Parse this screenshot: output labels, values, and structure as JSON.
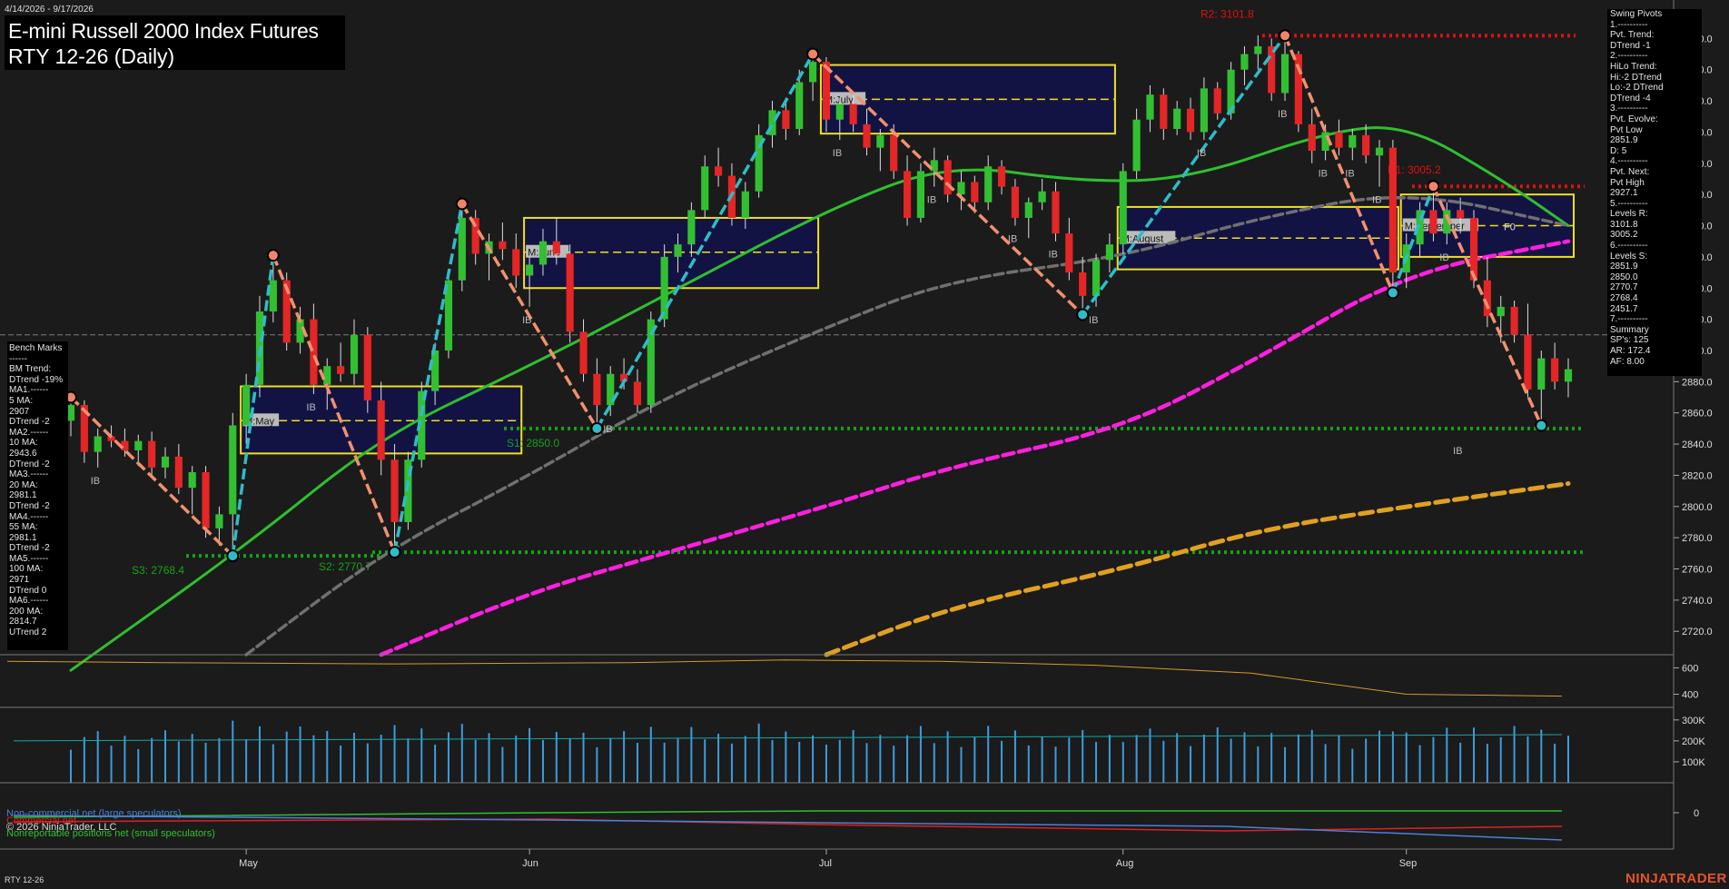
{
  "header": {
    "date_range": "4/14/2026 - 9/17/2026",
    "title_line1": "E-mini Russell 2000 Index Futures",
    "title_line2": "RTY 12-26 (Daily)",
    "instrument_footer": "RTY 12-26",
    "brand": "NINJATRADER"
  },
  "benchmarks": {
    "title": "Bench Marks",
    "lines": [
      "------",
      "BM Trend:",
      "DTrend -19%",
      "MA1.------",
      "5 MA:",
      "2907",
      "DTrend -2",
      "MA2.------",
      "10 MA:",
      "2943.6",
      "DTrend -2",
      "MA3.------",
      "20 MA:",
      "2981.1",
      "DTrend -2",
      "MA4.------",
      "55 MA:",
      "2981.1",
      "DTrend -2",
      "MA5.------",
      "100 MA:",
      "2971",
      "DTrend 0",
      "MA6.------",
      "200 MA:",
      "2814.7",
      "UTrend 2"
    ]
  },
  "swing_pivots": {
    "title": "Swing Pivots",
    "lines": [
      "1.----------",
      "Pvt. Trend:",
      "DTrend -1",
      "2.----------",
      "HiLo Trend:",
      "Hi:-2 DTrend",
      "Lo:-2 DTrend",
      "DTrend -4",
      "3.----------",
      "Pvt. Evolve:",
      "Pvt Low",
      "2851.9",
      "D: 5",
      "4.----------",
      "Pvt. Next:",
      "Pvt High",
      "2927.1",
      "5.----------",
      "Levels R:",
      "3101.8",
      "3005.2",
      "6.----------",
      "Levels S:",
      "2851.9",
      "2850.0",
      "2770.7",
      "2768.4",
      "2451.7",
      "7.----------",
      "Summary",
      "SP's: 125",
      "AR: 172.4",
      "AF: 8.00"
    ]
  },
  "cot": {
    "noncommercial": "Non-commercial net (large speculators)",
    "commercial": "Commercial net",
    "copyright": "© 2026 NinjaTrader, LLC",
    "nonreportable": "Nonreportable positions net (small speculators)"
  },
  "colors": {
    "background": "#1b1b1b",
    "up_candle": "#32c032",
    "down_candle": "#e42626",
    "ma_green": "#2fbf2f",
    "ma_gray": "#707070",
    "ma_magenta": "#ff1fe0",
    "ma_gold": "#e0a020",
    "swing_up": "#2fbcc8",
    "swing_down": "#f2906e",
    "resistance": "#e01010",
    "support": "#16a316",
    "box_border": "#f0e020",
    "box_fill": "#12124a"
  },
  "chart_data": {
    "type": "candlestick",
    "y_axis": {
      "min": 2705,
      "max": 3120,
      "ticks": [
        3100,
        3080,
        3060,
        3040,
        3020,
        3000,
        2980,
        2960,
        2940,
        2920,
        2900,
        2880,
        2860,
        2840,
        2820,
        2800,
        2780,
        2760,
        2740,
        2720
      ]
    },
    "x_axis": {
      "start_date": "4/14/2026",
      "end_date": "9/17/2026",
      "month_labels": [
        {
          "label": "May",
          "date": "5/1"
        },
        {
          "label": "Jun",
          "date": "6/1"
        },
        {
          "label": "Jul",
          "date": "7/1"
        },
        {
          "label": "Aug",
          "date": "8/3"
        },
        {
          "label": "Sep",
          "date": "9/1"
        }
      ]
    },
    "swing_points": [
      {
        "date": "4/14",
        "price": 2870,
        "type": "high"
      },
      {
        "date": "4/30",
        "price": 2768.4,
        "type": "low"
      },
      {
        "date": "5/5",
        "price": 2961,
        "type": "high"
      },
      {
        "date": "5/18",
        "price": 2770.7,
        "type": "low"
      },
      {
        "date": "5/25",
        "price": 2994,
        "type": "high"
      },
      {
        "date": "6/8",
        "price": 2850,
        "type": "low"
      },
      {
        "date": "6/30",
        "price": 3090,
        "type": "high"
      },
      {
        "date": "7/29",
        "price": 2923,
        "type": "low"
      },
      {
        "date": "8/19",
        "price": 3101.8,
        "type": "high"
      },
      {
        "date": "8/31",
        "price": 2937,
        "type": "low"
      },
      {
        "date": "9/3",
        "price": 3005.2,
        "type": "high"
      },
      {
        "date": "9/15",
        "price": 2851.9,
        "type": "low"
      }
    ],
    "ma_series": [
      {
        "name": "20 MA",
        "points": [
          [
            "4/14",
            2695
          ],
          [
            "5/1",
            2775
          ],
          [
            "5/15",
            2845
          ],
          [
            "6/1",
            2890
          ],
          [
            "6/15",
            2935
          ],
          [
            "7/1",
            2990
          ],
          [
            "7/15",
            3020
          ],
          [
            "7/29",
            3008
          ],
          [
            "8/10",
            3010
          ],
          [
            "8/24",
            3040
          ],
          [
            "9/1",
            3045
          ],
          [
            "9/10",
            3010
          ],
          [
            "9/17",
            2980
          ]
        ]
      },
      {
        "name": "55 MA",
        "points": [
          [
            "5/1",
            2705
          ],
          [
            "5/15",
            2770
          ],
          [
            "6/1",
            2820
          ],
          [
            "6/15",
            2870
          ],
          [
            "7/1",
            2915
          ],
          [
            "7/15",
            2945
          ],
          [
            "8/1",
            2960
          ],
          [
            "8/15",
            2985
          ],
          [
            "9/1",
            3003
          ],
          [
            "9/17",
            2980
          ]
        ]
      },
      {
        "name": "100 MA",
        "points": [
          [
            "5/15",
            2705
          ],
          [
            "6/1",
            2745
          ],
          [
            "6/15",
            2770
          ],
          [
            "7/1",
            2800
          ],
          [
            "7/15",
            2825
          ],
          [
            "8/1",
            2850
          ],
          [
            "8/15",
            2895
          ],
          [
            "9/1",
            2950
          ],
          [
            "9/17",
            2970
          ]
        ]
      },
      {
        "name": "200 MA",
        "points": [
          [
            "7/1",
            2705
          ],
          [
            "7/15",
            2735
          ],
          [
            "8/1",
            2760
          ],
          [
            "8/15",
            2785
          ],
          [
            "9/1",
            2800
          ],
          [
            "9/17",
            2814.7
          ]
        ]
      }
    ],
    "levels": [
      {
        "label": "R2: 3101.8",
        "price": 3101.8,
        "kind": "resistance"
      },
      {
        "label": "R1: 3005.2",
        "price": 3005.2,
        "kind": "resistance"
      },
      {
        "label": "S1: 2850.0",
        "price": 2850.0,
        "kind": "support"
      },
      {
        "label": "S2: 2770.7",
        "price": 2770.7,
        "kind": "support"
      },
      {
        "label": "S3: 2768.4",
        "price": 2768.4,
        "kind": "support"
      }
    ],
    "value_area_boxes": [
      {
        "label": "M:May",
        "start": "5/1",
        "end": "5/29",
        "high": 2877,
        "low": 2834,
        "poc": 2855
      },
      {
        "label": "M:June",
        "start": "6/1",
        "end": "6/30",
        "high": 2985,
        "low": 2940,
        "poc": 2963
      },
      {
        "label": "M:July",
        "start": "7/1",
        "end": "7/31",
        "high": 3083,
        "low": 3039,
        "poc": 3061
      },
      {
        "label": "M:August",
        "start": "8/3",
        "end": "8/31",
        "high": 2992,
        "low": 2952,
        "poc": 2972
      },
      {
        "label": "M:September",
        "start": "9/1",
        "end": "9/17",
        "high": 3000,
        "low": 2960,
        "poc": 2980
      }
    ],
    "ib_labels": [
      [
        "4/16",
        "IB"
      ],
      [
        "5/8",
        "IB"
      ],
      [
        "6/1",
        "IB"
      ],
      [
        "6/9",
        "IB"
      ],
      [
        "7/2",
        "IB"
      ],
      [
        "7/14",
        "IB"
      ],
      [
        "7/22",
        "IB"
      ],
      [
        "7/27",
        "IB"
      ],
      [
        "7/30",
        "IB"
      ],
      [
        "8/11",
        "IB"
      ],
      [
        "8/19",
        "IB"
      ],
      [
        "8/24",
        "IB"
      ],
      [
        "8/26",
        "IB"
      ],
      [
        "8/28",
        "IB"
      ],
      [
        "9/4",
        "IB"
      ],
      [
        "9/6",
        "IB"
      ]
    ],
    "f0_label": "F0",
    "candles": [
      [
        "4/14",
        2855,
        2872,
        2845,
        2865
      ],
      [
        "4/15",
        2865,
        2868,
        2828,
        2835
      ],
      [
        "4/16",
        2835,
        2850,
        2825,
        2845
      ],
      [
        "4/17",
        2845,
        2852,
        2838,
        2842
      ],
      [
        "4/20",
        2842,
        2850,
        2832,
        2836
      ],
      [
        "4/21",
        2836,
        2846,
        2826,
        2842
      ],
      [
        "4/22",
        2842,
        2848,
        2820,
        2825
      ],
      [
        "4/23",
        2825,
        2838,
        2818,
        2832
      ],
      [
        "4/24",
        2832,
        2840,
        2808,
        2812
      ],
      [
        "4/27",
        2812,
        2826,
        2795,
        2822
      ],
      [
        "4/28",
        2822,
        2826,
        2780,
        2786
      ],
      [
        "4/29",
        2786,
        2800,
        2775,
        2795
      ],
      [
        "4/30",
        2795,
        2860,
        2768,
        2852
      ],
      [
        "5/1",
        2852,
        2885,
        2840,
        2878
      ],
      [
        "5/4",
        2878,
        2935,
        2870,
        2925
      ],
      [
        "5/5",
        2925,
        2961,
        2918,
        2945
      ],
      [
        "5/6",
        2945,
        2950,
        2900,
        2905
      ],
      [
        "5/7",
        2905,
        2928,
        2898,
        2920
      ],
      [
        "5/8",
        2920,
        2930,
        2872,
        2878
      ],
      [
        "5/11",
        2878,
        2895,
        2862,
        2890
      ],
      [
        "5/12",
        2890,
        2905,
        2880,
        2885
      ],
      [
        "5/13",
        2885,
        2920,
        2878,
        2910
      ],
      [
        "5/14",
        2910,
        2915,
        2860,
        2868
      ],
      [
        "5/15",
        2868,
        2880,
        2820,
        2830
      ],
      [
        "5/18",
        2830,
        2840,
        2770,
        2790
      ],
      [
        "5/19",
        2790,
        2835,
        2785,
        2830
      ],
      [
        "5/20",
        2830,
        2880,
        2825,
        2874
      ],
      [
        "5/21",
        2874,
        2905,
        2865,
        2900
      ],
      [
        "5/22",
        2900,
        2950,
        2895,
        2945
      ],
      [
        "5/25",
        2945,
        2994,
        2938,
        2985
      ],
      [
        "5/26",
        2985,
        2990,
        2955,
        2962
      ],
      [
        "5/27",
        2962,
        2975,
        2945,
        2970
      ],
      [
        "5/28",
        2970,
        2982,
        2958,
        2965
      ],
      [
        "5/29",
        2965,
        2975,
        2940,
        2948
      ],
      [
        "6/1",
        2948,
        2960,
        2928,
        2955
      ],
      [
        "6/2",
        2955,
        2978,
        2948,
        2970
      ],
      [
        "6/3",
        2970,
        2985,
        2955,
        2962
      ],
      [
        "6/4",
        2962,
        2968,
        2905,
        2912
      ],
      [
        "6/5",
        2912,
        2920,
        2880,
        2885
      ],
      [
        "6/8",
        2885,
        2895,
        2850,
        2865
      ],
      [
        "6/9",
        2865,
        2890,
        2858,
        2885
      ],
      [
        "6/10",
        2885,
        2895,
        2875,
        2880
      ],
      [
        "6/11",
        2880,
        2888,
        2860,
        2865
      ],
      [
        "6/12",
        2865,
        2925,
        2860,
        2920
      ],
      [
        "6/15",
        2920,
        2968,
        2915,
        2960
      ],
      [
        "6/16",
        2960,
        2975,
        2950,
        2968
      ],
      [
        "6/17",
        2968,
        2995,
        2960,
        2990
      ],
      [
        "6/18",
        2990,
        3025,
        2985,
        3018
      ],
      [
        "6/19",
        3018,
        3030,
        3005,
        3012
      ],
      [
        "6/22",
        3012,
        3020,
        2980,
        2985
      ],
      [
        "6/23",
        2985,
        3008,
        2978,
        3002
      ],
      [
        "6/24",
        3002,
        3045,
        2998,
        3038
      ],
      [
        "6/25",
        3038,
        3060,
        3030,
        3054
      ],
      [
        "6/26",
        3054,
        3062,
        3035,
        3042
      ],
      [
        "6/29",
        3042,
        3080,
        3038,
        3072
      ],
      [
        "6/30",
        3072,
        3090,
        3060,
        3085
      ],
      [
        "7/1",
        3085,
        3088,
        3040,
        3048
      ],
      [
        "7/2",
        3048,
        3062,
        3035,
        3058
      ],
      [
        "7/6",
        3058,
        3065,
        3040,
        3045
      ],
      [
        "7/7",
        3045,
        3055,
        3025,
        3030
      ],
      [
        "7/8",
        3030,
        3042,
        3015,
        3038
      ],
      [
        "7/9",
        3038,
        3045,
        3010,
        3015
      ],
      [
        "7/10",
        3015,
        3025,
        2980,
        2985
      ],
      [
        "7/13",
        2985,
        3020,
        2982,
        3015
      ],
      [
        "7/14",
        3015,
        3030,
        3005,
        3022
      ],
      [
        "7/15",
        3022,
        3025,
        2995,
        3000
      ],
      [
        "7/16",
        3000,
        3015,
        2990,
        3008
      ],
      [
        "7/17",
        3008,
        3012,
        2988,
        2995
      ],
      [
        "7/20",
        2995,
        3025,
        2990,
        3018
      ],
      [
        "7/21",
        3018,
        3022,
        3000,
        3005
      ],
      [
        "7/22",
        3005,
        3010,
        2980,
        2985
      ],
      [
        "7/23",
        2985,
        2998,
        2972,
        2995
      ],
      [
        "7/24",
        2995,
        3010,
        2990,
        3002
      ],
      [
        "7/27",
        3002,
        3008,
        2970,
        2975
      ],
      [
        "7/28",
        2975,
        2985,
        2945,
        2950
      ],
      [
        "7/29",
        2950,
        2960,
        2923,
        2935
      ],
      [
        "7/30",
        2935,
        2962,
        2928,
        2958
      ],
      [
        "7/31",
        2958,
        2975,
        2950,
        2968
      ],
      [
        "8/3",
        2968,
        3020,
        2962,
        3015
      ],
      [
        "8/4",
        3015,
        3055,
        3010,
        3048
      ],
      [
        "8/5",
        3048,
        3070,
        3040,
        3064
      ],
      [
        "8/6",
        3064,
        3068,
        3035,
        3042
      ],
      [
        "8/7",
        3042,
        3060,
        3038,
        3055
      ],
      [
        "8/10",
        3055,
        3062,
        3035,
        3040
      ],
      [
        "8/11",
        3040,
        3075,
        3035,
        3068
      ],
      [
        "8/12",
        3068,
        3072,
        3048,
        3052
      ],
      [
        "8/13",
        3052,
        3085,
        3048,
        3080
      ],
      [
        "8/14",
        3080,
        3095,
        3070,
        3090
      ],
      [
        "8/17",
        3090,
        3102,
        3080,
        3095
      ],
      [
        "8/18",
        3095,
        3100,
        3060,
        3065
      ],
      [
        "8/19",
        3065,
        3101.8,
        3060,
        3090
      ],
      [
        "8/20",
        3090,
        3092,
        3040,
        3045
      ],
      [
        "8/21",
        3045,
        3055,
        3020,
        3028
      ],
      [
        "8/24",
        3028,
        3045,
        3022,
        3040
      ],
      [
        "8/25",
        3040,
        3048,
        3025,
        3030
      ],
      [
        "8/26",
        3030,
        3042,
        3022,
        3038
      ],
      [
        "8/27",
        3038,
        3045,
        3020,
        3025
      ],
      [
        "8/28",
        3025,
        3035,
        3005,
        3030
      ],
      [
        "8/31",
        3030,
        3035,
        2937,
        2950
      ],
      [
        "9/1",
        2950,
        2975,
        2940,
        2968
      ],
      [
        "9/2",
        2968,
        2995,
        2960,
        2990
      ],
      [
        "9/3",
        2990,
        3005.2,
        2970,
        2975
      ],
      [
        "9/4",
        2975,
        2995,
        2968,
        2990
      ],
      [
        "9/7",
        2990,
        2998,
        2975,
        2985
      ],
      [
        "9/8",
        2985,
        2990,
        2940,
        2945
      ],
      [
        "9/9",
        2945,
        2960,
        2915,
        2922
      ],
      [
        "9/10",
        2922,
        2935,
        2905,
        2928
      ],
      [
        "9/11",
        2928,
        2932,
        2905,
        2910
      ],
      [
        "9/14",
        2910,
        2930,
        2870,
        2875
      ],
      [
        "9/15",
        2875,
        2900,
        2851.9,
        2895
      ],
      [
        "9/16",
        2895,
        2905,
        2875,
        2880
      ],
      [
        "9/17",
        2880,
        2895,
        2870,
        2888
      ]
    ],
    "volatility": {
      "axis_ticks": [
        600,
        400
      ],
      "min": 300,
      "max": 700
    },
    "volume": {
      "axis_ticks": [
        "300K",
        "200K",
        "100K"
      ],
      "min": 0,
      "max": 360000
    },
    "cot_axis_ticks": [
      "0"
    ]
  }
}
